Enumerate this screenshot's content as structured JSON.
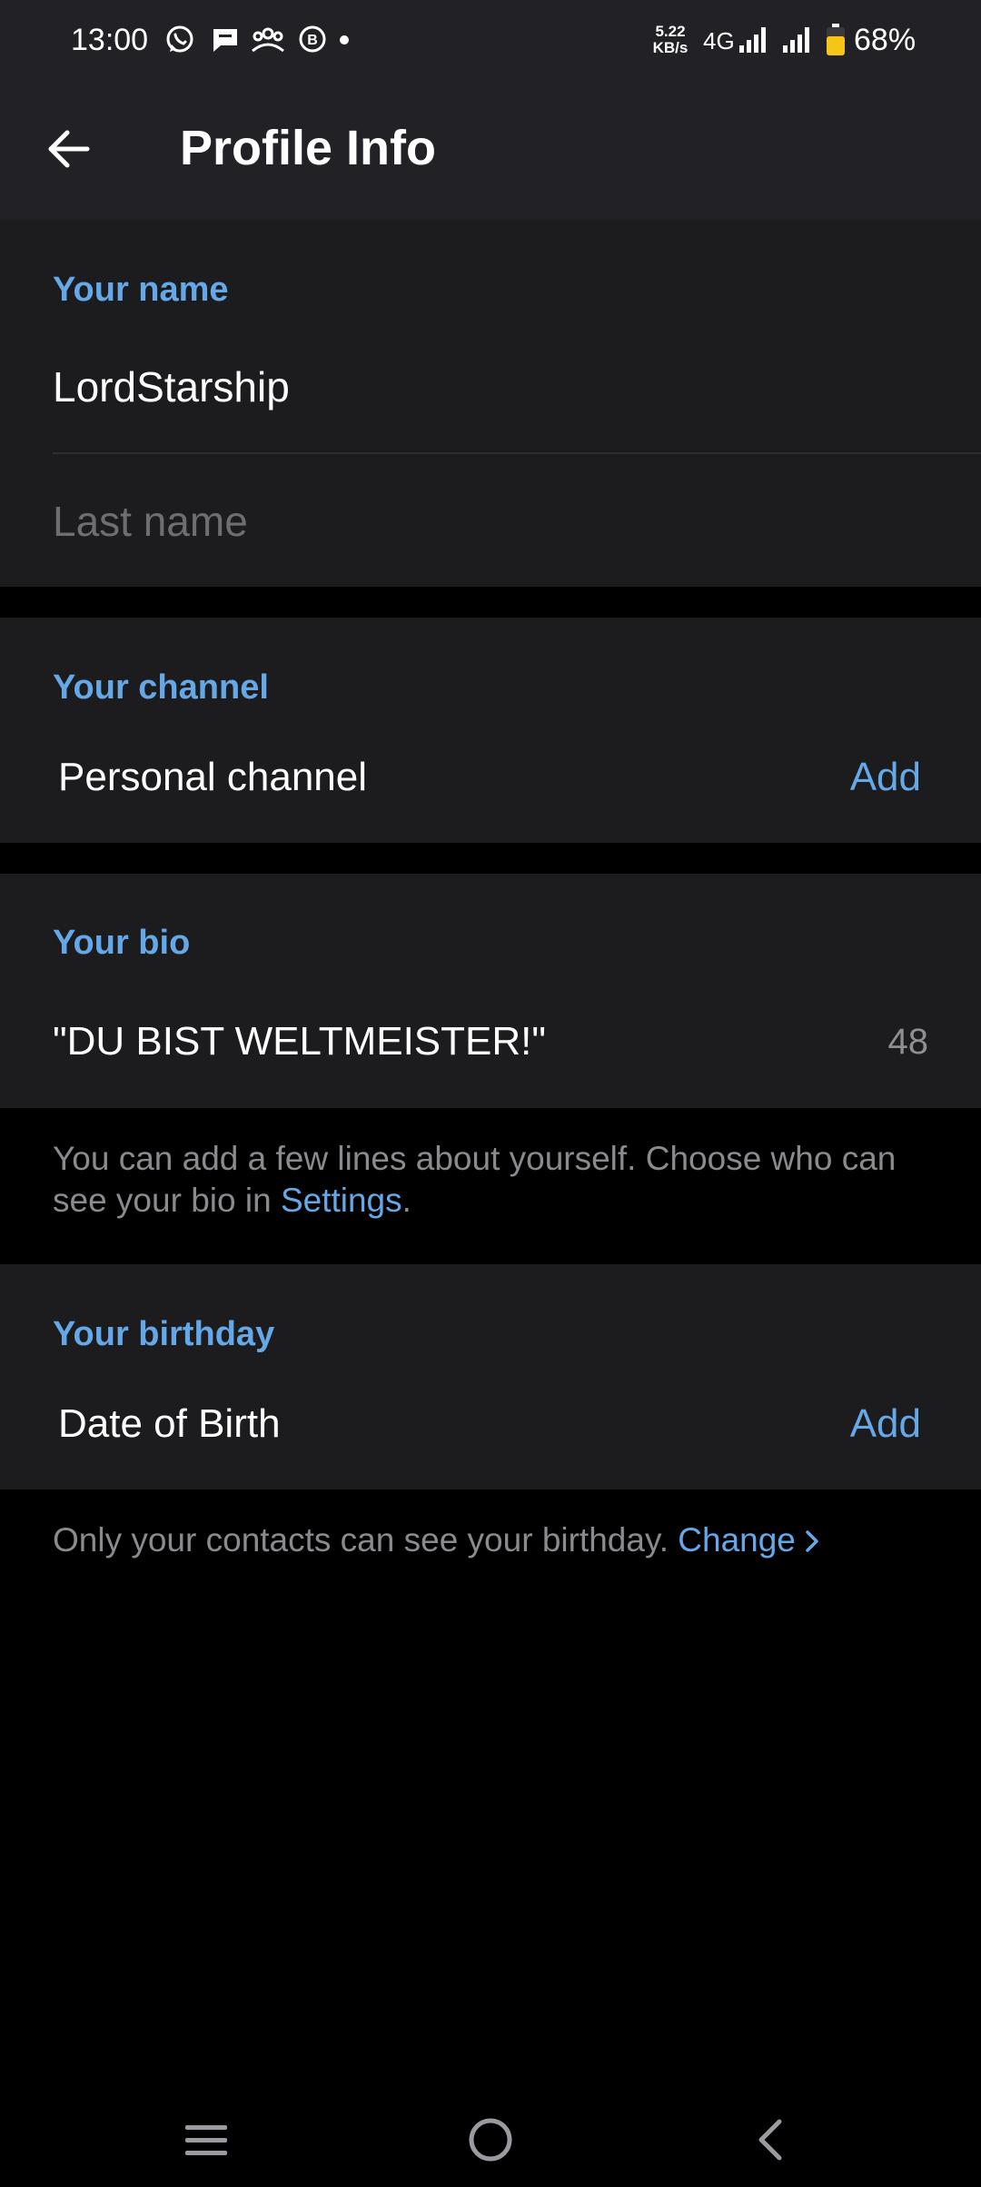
{
  "status_bar": {
    "time": "13:00",
    "notification_icons": [
      "whatsapp-icon",
      "chat-bubble-icon",
      "group-icon",
      "business-icon",
      "dot-icon"
    ],
    "net_speed_value": "5.22",
    "net_speed_unit": "KB/s",
    "network_type": "4G",
    "battery_percent": "68%",
    "battery_level": 0.68,
    "battery_color": "#f5c518"
  },
  "app_bar": {
    "title": "Profile Info",
    "back_icon": "arrow-left-icon"
  },
  "name_section": {
    "header": "Your name",
    "first_name": "LordStarship",
    "last_name_placeholder": "Last name"
  },
  "channel_section": {
    "header": "Your channel",
    "label": "Personal channel",
    "action": "Add"
  },
  "bio_section": {
    "header": "Your bio",
    "value": "\"DU BIST WELTMEISTER!\"",
    "remaining": "48",
    "hint_prefix": "You can add a few lines about yourself. Choose who can see your bio in ",
    "hint_link": "Settings",
    "hint_suffix": "."
  },
  "birthday_section": {
    "header": "Your birthday",
    "label": "Date of Birth",
    "action": "Add",
    "hint_prefix": "Only your contacts can see your birthday. ",
    "hint_link": "Change",
    "hint_link_icon": "chevron-right-icon"
  },
  "nav_bar": {
    "icons": [
      "menu-icon",
      "home-icon",
      "back-icon"
    ]
  },
  "colors": {
    "accent": "#64a8e8",
    "surface": "#1c1c1e",
    "appbar": "#222226",
    "background": "#000000"
  }
}
